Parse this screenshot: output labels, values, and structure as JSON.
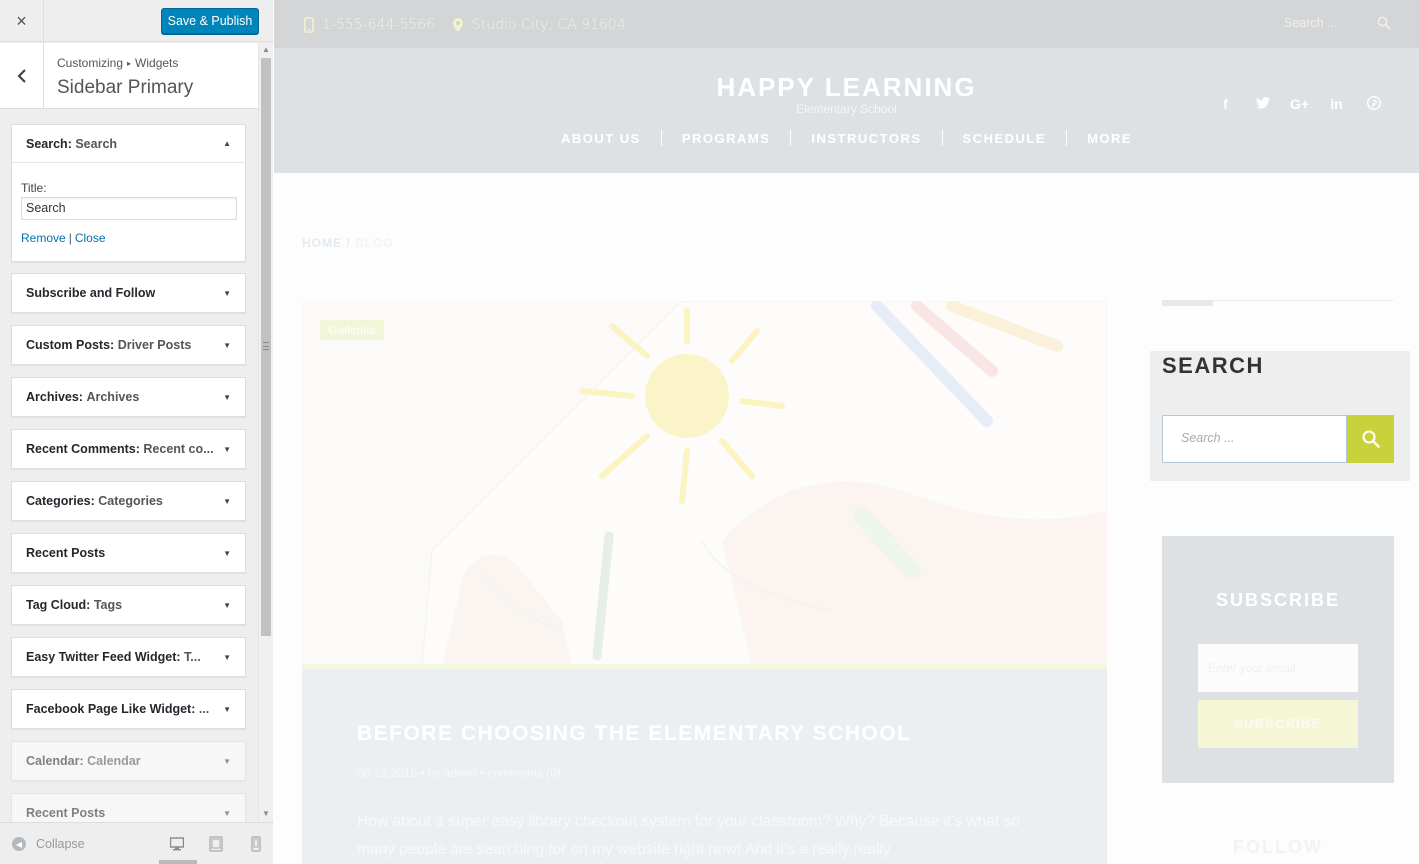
{
  "customizer": {
    "close_label": "×",
    "save_label": "Save & Publish",
    "breadcrumb_root": "Customizing",
    "breadcrumb_sep": "▸",
    "breadcrumb_current": "Widgets",
    "section_title": "Sidebar Primary",
    "search_widget": {
      "name": "Search:",
      "title": "Search",
      "field_label": "Title:",
      "field_value": "Search",
      "remove_label": "Remove",
      "separator": "|",
      "close_label": "Close"
    },
    "widgets": [
      {
        "name": "Subscribe and Follow",
        "title": ""
      },
      {
        "name": "Custom Posts:",
        "title": "Driver Posts"
      },
      {
        "name": "Archives:",
        "title": "Archives"
      },
      {
        "name": "Recent Comments:",
        "title": "Recent co..."
      },
      {
        "name": "Categories:",
        "title": "Categories"
      },
      {
        "name": "Recent Posts",
        "title": ""
      },
      {
        "name": "Tag Cloud:",
        "title": "Tags"
      },
      {
        "name": "Easy Twitter Feed Widget:",
        "title": "T..."
      },
      {
        "name": "Facebook Page Like Widget:",
        "title": "..."
      },
      {
        "name": "Calendar:",
        "title": "Calendar"
      },
      {
        "name": "Recent Posts",
        "title": ""
      }
    ],
    "collapse_label": "Collapse"
  },
  "site": {
    "phone": "1-555-644-5566",
    "address": "Studio City, CA 91604",
    "search_placeholder": "Search ...",
    "title": "HAPPY LEARNING",
    "tagline": "Elementary School",
    "social_icons": [
      "facebook-icon",
      "twitter-icon",
      "google-plus-icon",
      "linkedin-icon",
      "pinterest-icon"
    ],
    "nav": [
      "ABOUT US",
      "PROGRAMS",
      "INSTRUCTORS",
      "SCHEDULE",
      "MORE"
    ],
    "breadcrumb_home": "HOME",
    "breadcrumb_sep": "/",
    "breadcrumb_current": "BLOG",
    "post": {
      "category": "Galleries",
      "title": "BEFORE CHOOSING THE ELEMENTARY SCHOOL",
      "meta": "08.12.2016  •  by admin  •  comments (0)",
      "excerpt": "How about a super easy library checkout system for your classroom? Why? Because it's what so many people are searching for on my website right now! And it's a really really"
    },
    "sidebar": {
      "search_title": "SEARCH",
      "search_placeholder": "Search ...",
      "subscribe_title": "SUBSCRIBE",
      "email_placeholder": "Enter your email",
      "subscribe_button": "SUBSCRIBE",
      "follow_title": "FOLLOW"
    }
  },
  "colors": {
    "accent": "#c8d33b",
    "primary_button": "#0085ba",
    "link": "#0073aa"
  }
}
